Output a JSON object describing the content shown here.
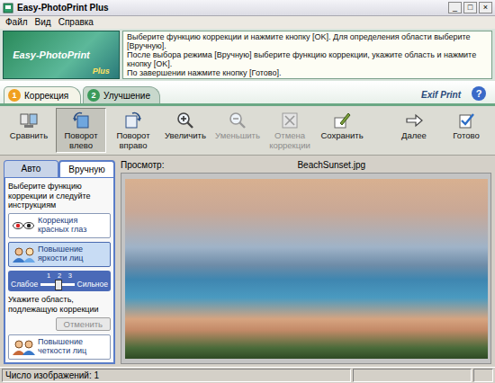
{
  "window": {
    "title": "Easy-PhotoPrint Plus",
    "controls": [
      "_",
      "□",
      "×"
    ]
  },
  "menu": [
    "Файл",
    "Вид",
    "Справка"
  ],
  "logo": {
    "text": "Easy-PhotoPrint",
    "badge": "Plus"
  },
  "instructions": [
    "Выберите функцию коррекции и нажмите кнопку [OK]. Для определения области выберите [Вручную].",
    "После выбора режима [Вручную] выберите функцию коррекции, укажите область и нажмите кнопку [OK].",
    "По завершении нажмите кнопку [Готово]."
  ],
  "steps": [
    {
      "number": "1",
      "label": "Коррекция",
      "selected": true
    },
    {
      "number": "2",
      "label": "Улучшение",
      "selected": false
    }
  ],
  "exif_logo": "Exif Print",
  "help": "?",
  "toolbar": {
    "left": [
      {
        "label": "Сравнить",
        "disabled": false,
        "selected": false
      },
      {
        "label": "Поворот влево",
        "disabled": false,
        "selected": true
      },
      {
        "label": "Поворот вправо",
        "disabled": false,
        "selected": false
      },
      {
        "label": "Увеличить",
        "disabled": false,
        "selected": false
      },
      {
        "label": "Уменьшить",
        "disabled": true,
        "selected": false
      },
      {
        "label": "Отмена коррекции",
        "disabled": true,
        "selected": false
      },
      {
        "label": "Сохранить",
        "disabled": false,
        "selected": false
      }
    ],
    "right": [
      {
        "label": "Далее",
        "disabled": false,
        "selected": false
      },
      {
        "label": "Готово",
        "disabled": false,
        "selected": false
      }
    ]
  },
  "sidebar": {
    "tabs": [
      {
        "label": "Авто",
        "selected": false
      },
      {
        "label": "Вручную",
        "selected": true
      }
    ],
    "intro": "Выберите функцию коррекции и следуйте инструкциям",
    "items": [
      {
        "kind": "button",
        "label": "Коррекция красных глаз",
        "selected": false
      },
      {
        "kind": "button",
        "label": "Повышение яркости лиц",
        "selected": true
      },
      {
        "kind": "slider",
        "min_label": "Слабое",
        "max_label": "Сильное",
        "ticks": [
          "1",
          "2",
          "3"
        ],
        "level": 0.5
      },
      {
        "kind": "note",
        "text": "Укажите область, подлежащую коррекции"
      },
      {
        "kind": "action",
        "label": "Отменить",
        "disabled": true
      },
      {
        "kind": "button",
        "label": "Повышение четкости лиц",
        "selected": false
      }
    ]
  },
  "preview": {
    "label": "Просмотр:",
    "filename": "BeachSunset.jpg"
  },
  "status_bar": {
    "text": "Число изображений: 1"
  }
}
